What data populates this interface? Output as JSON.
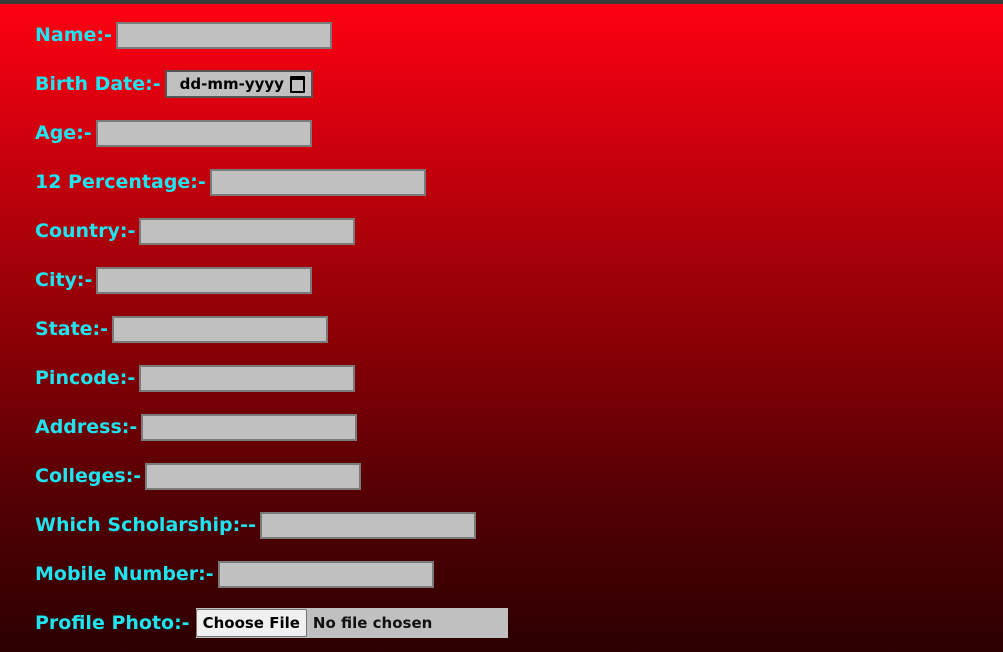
{
  "form": {
    "name_label": "Name:-",
    "birth_label": "Birth Date:-",
    "birth_placeholder": "dd-mm-yyyy",
    "age_label": "Age:-",
    "percentage_label": "12 Percentage:-",
    "country_label": "Country:-",
    "city_label": "City:-",
    "state_label": "State:-",
    "pincode_label": "Pincode:-",
    "address_label": "Address:-",
    "colleges_label": "Colleges:-",
    "scholarship_label": "Which Scholarship:--",
    "mobile_label": "Mobile Number:-",
    "photo_label": "Profile Photo:-",
    "choose_file_label": "Choose File",
    "file_status": "No file chosen"
  },
  "colors": {
    "label": "#1fe3ef",
    "input_bg": "#c0c0c0",
    "gradient_top": "#ff0012",
    "gradient_bottom": "#2c0002"
  }
}
